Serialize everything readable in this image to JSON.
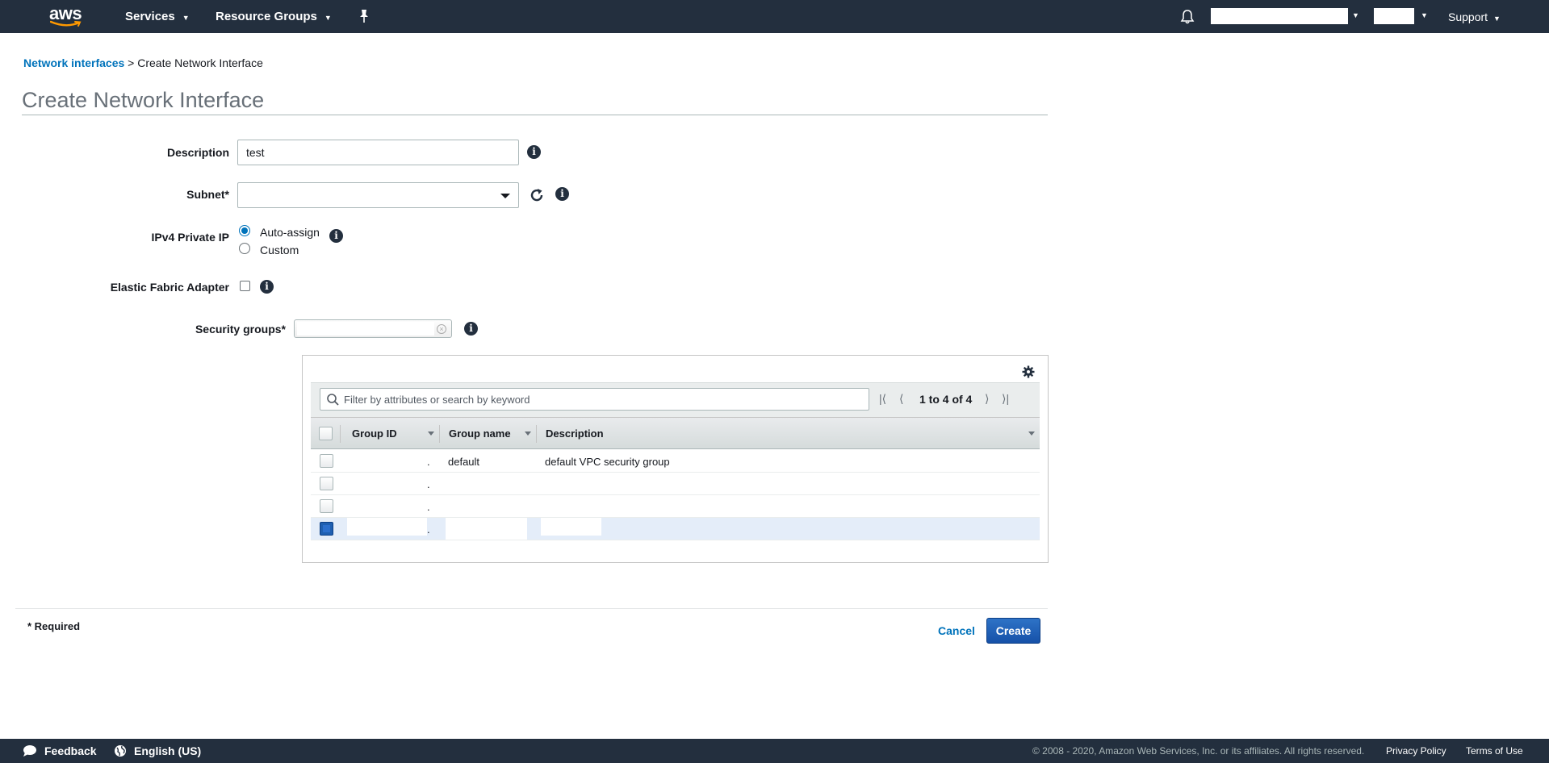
{
  "colors": {
    "nav_bg": "#232f3e",
    "link": "#0073bb",
    "primary_button": "#1f5fb0",
    "selected_row": "#e4edf9"
  },
  "topnav": {
    "logo_text": "aws",
    "services": "Services",
    "resource_groups": "Resource Groups",
    "support": "Support"
  },
  "breadcrumb": {
    "link": "Network interfaces",
    "separator": ">",
    "current": "Create Network Interface"
  },
  "page": {
    "title": "Create Network Interface"
  },
  "form": {
    "description": {
      "label": "Description",
      "value": "test"
    },
    "subnet": {
      "label": "Subnet*",
      "value": ""
    },
    "ipv4": {
      "label": "IPv4 Private IP",
      "options": [
        "Auto-assign",
        "Custom"
      ],
      "selected": "Auto-assign"
    },
    "efa": {
      "label": "Elastic Fabric Adapter",
      "checked": false
    },
    "security_groups": {
      "label": "Security groups*"
    }
  },
  "sg_table": {
    "filter_placeholder": "Filter by attributes or search by keyword",
    "pagination": "1 to 4 of 4",
    "columns": [
      "Group ID",
      "Group name",
      "Description"
    ],
    "rows": [
      {
        "group_id": ".",
        "group_name": "default",
        "description": "default VPC security group",
        "selected": false
      },
      {
        "group_id": ".",
        "group_name": "",
        "description": "",
        "selected": false
      },
      {
        "group_id": ".",
        "group_name": "",
        "description": "",
        "selected": false
      },
      {
        "group_id": ".",
        "group_name": "",
        "description": "",
        "selected": true
      }
    ]
  },
  "footer_form": {
    "required_note": "* Required",
    "cancel": "Cancel",
    "create": "Create"
  },
  "bottombar": {
    "feedback": "Feedback",
    "language": "English (US)",
    "copyright": "© 2008 - 2020, Amazon Web Services, Inc. or its affiliates. All rights reserved.",
    "privacy": "Privacy Policy",
    "terms": "Terms of Use"
  },
  "icons": [
    "aws-logo-icon",
    "chevron-down-icon",
    "pin-icon",
    "bell-icon",
    "info-icon",
    "refresh-icon",
    "clear-icon",
    "gear-icon",
    "search-icon",
    "first-page-icon",
    "prev-page-icon",
    "next-page-icon",
    "last-page-icon",
    "speech-bubble-icon",
    "globe-icon"
  ]
}
